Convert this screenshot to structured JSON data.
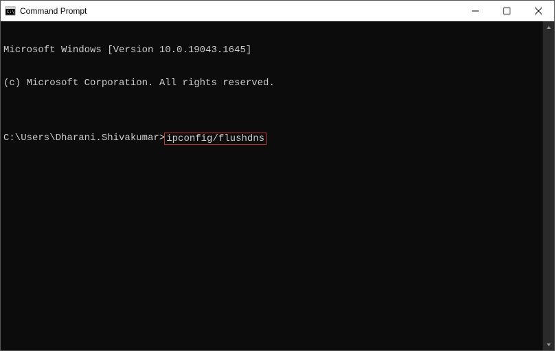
{
  "window": {
    "title": "Command Prompt"
  },
  "terminal": {
    "line1": "Microsoft Windows [Version 10.0.19043.1645]",
    "line2": "(c) Microsoft Corporation. All rights reserved.",
    "blank": "",
    "prompt": "C:\\Users\\Dharani.Shivakumar>",
    "command": "ipconfig/flushdns"
  }
}
